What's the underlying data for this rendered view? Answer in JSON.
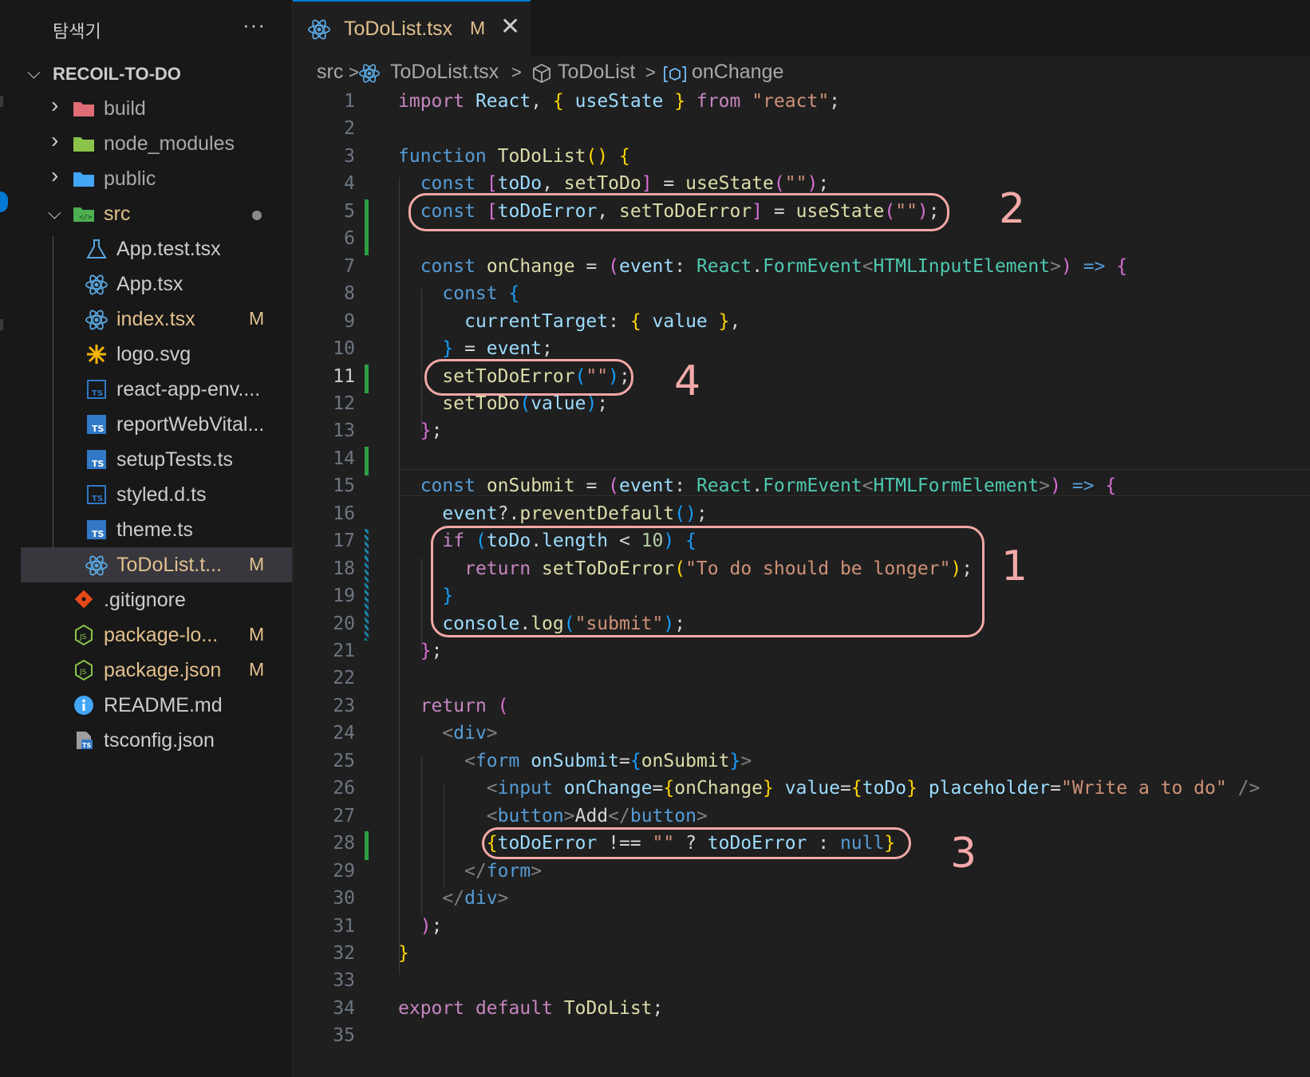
{
  "explorer": {
    "title": "탐색기",
    "more": "···",
    "project": "RECOIL-TO-DO",
    "items": [
      {
        "label": "build",
        "kind": "folder",
        "icon_color": "#e06c75"
      },
      {
        "label": "node_modules",
        "kind": "folder",
        "icon_color": "#8bc34a"
      },
      {
        "label": "public",
        "kind": "folder",
        "icon_color": "#42a5f5"
      },
      {
        "label": "src",
        "kind": "folder-open",
        "icon_color": "#4caf50"
      },
      {
        "label": "App.test.tsx",
        "kind": "test"
      },
      {
        "label": "App.tsx",
        "kind": "react"
      },
      {
        "label": "index.tsx",
        "kind": "react",
        "badge": "M"
      },
      {
        "label": "logo.svg",
        "kind": "svg"
      },
      {
        "label": "react-app-env....",
        "kind": "ts-outline"
      },
      {
        "label": "reportWebVital...",
        "kind": "ts"
      },
      {
        "label": "setupTests.ts",
        "kind": "ts"
      },
      {
        "label": "styled.d.ts",
        "kind": "ts-outline"
      },
      {
        "label": "theme.ts",
        "kind": "ts"
      },
      {
        "label": "ToDoList.t...",
        "kind": "react",
        "badge": "M"
      },
      {
        "label": ".gitignore",
        "kind": "git"
      },
      {
        "label": "package-lo...",
        "kind": "node",
        "badge": "M"
      },
      {
        "label": "package.json",
        "kind": "node",
        "badge": "M"
      },
      {
        "label": "README.md",
        "kind": "info"
      },
      {
        "label": "tsconfig.json",
        "kind": "tsconfig"
      }
    ]
  },
  "tab": {
    "name": "ToDoList.tsx",
    "modified": "M",
    "close": "✕"
  },
  "breadcrumb": {
    "src": "src",
    "file": "ToDoList.tsx",
    "component": "ToDoList",
    "symbol": "onChange",
    "sep": ">"
  },
  "editor": {
    "current_line": 11,
    "lines": [
      [
        [
          "cf",
          "import"
        ],
        [
          "pl",
          " "
        ],
        [
          "va",
          "React"
        ],
        [
          "pl",
          ", "
        ],
        [
          "br1",
          "{"
        ],
        [
          "pl",
          " "
        ],
        [
          "va",
          "useState"
        ],
        [
          "pl",
          " "
        ],
        [
          "br1",
          "}"
        ],
        [
          "pl",
          " "
        ],
        [
          "cf",
          "from"
        ],
        [
          "pl",
          " "
        ],
        [
          "st",
          "\"react\""
        ],
        [
          "pl",
          ";"
        ]
      ],
      [],
      [
        [
          "kw",
          "function"
        ],
        [
          "pl",
          " "
        ],
        [
          "fn",
          "ToDoList"
        ],
        [
          "br1",
          "()"
        ],
        [
          "pl",
          " "
        ],
        [
          "br1",
          "{"
        ]
      ],
      [
        [
          "pl",
          "  "
        ],
        [
          "kw",
          "const"
        ],
        [
          "pl",
          " "
        ],
        [
          "br2",
          "["
        ],
        [
          "va",
          "toDo"
        ],
        [
          "pl",
          ", "
        ],
        [
          "fn",
          "setToDo"
        ],
        [
          "br2",
          "]"
        ],
        [
          "pl",
          " = "
        ],
        [
          "fn",
          "useState"
        ],
        [
          "br2",
          "("
        ],
        [
          "st",
          "\"\""
        ],
        [
          "br2",
          ")"
        ],
        [
          "pl",
          ";"
        ]
      ],
      [
        [
          "pl",
          "  "
        ],
        [
          "kw",
          "const"
        ],
        [
          "pl",
          " "
        ],
        [
          "br2",
          "["
        ],
        [
          "va",
          "toDoError"
        ],
        [
          "pl",
          ", "
        ],
        [
          "fn",
          "setToDoError"
        ],
        [
          "br2",
          "]"
        ],
        [
          "pl",
          " = "
        ],
        [
          "fn",
          "useState"
        ],
        [
          "br2",
          "("
        ],
        [
          "st",
          "\"\""
        ],
        [
          "br2",
          ")"
        ],
        [
          "pl",
          ";"
        ]
      ],
      [],
      [
        [
          "pl",
          "  "
        ],
        [
          "kw",
          "const"
        ],
        [
          "pl",
          " "
        ],
        [
          "fn",
          "onChange"
        ],
        [
          "pl",
          " = "
        ],
        [
          "br2",
          "("
        ],
        [
          "va",
          "event"
        ],
        [
          "pl",
          ": "
        ],
        [
          "ty",
          "React"
        ],
        [
          "pl",
          "."
        ],
        [
          "ty",
          "FormEvent"
        ],
        [
          "tg",
          "<"
        ],
        [
          "ty",
          "HTMLInputElement"
        ],
        [
          "tg",
          ">"
        ],
        [
          "br2",
          ")"
        ],
        [
          "pl",
          " "
        ],
        [
          "kw",
          "=>"
        ],
        [
          "pl",
          " "
        ],
        [
          "br2",
          "{"
        ]
      ],
      [
        [
          "pl",
          "    "
        ],
        [
          "kw",
          "const"
        ],
        [
          "pl",
          " "
        ],
        [
          "br3",
          "{"
        ]
      ],
      [
        [
          "pl",
          "      "
        ],
        [
          "va",
          "currentTarget"
        ],
        [
          "pl",
          ": "
        ],
        [
          "br1",
          "{"
        ],
        [
          "pl",
          " "
        ],
        [
          "va",
          "value"
        ],
        [
          "pl",
          " "
        ],
        [
          "br1",
          "}"
        ],
        [
          "pl",
          ","
        ]
      ],
      [
        [
          "pl",
          "    "
        ],
        [
          "br3",
          "}"
        ],
        [
          "pl",
          " = "
        ],
        [
          "va",
          "event"
        ],
        [
          "pl",
          ";"
        ]
      ],
      [
        [
          "pl",
          "    "
        ],
        [
          "fn",
          "setToDoError"
        ],
        [
          "br3",
          "("
        ],
        [
          "st",
          "\"\""
        ],
        [
          "br3",
          ")"
        ],
        [
          "pl",
          ";"
        ]
      ],
      [
        [
          "pl",
          "    "
        ],
        [
          "fn",
          "setToDo"
        ],
        [
          "br3",
          "("
        ],
        [
          "va",
          "value"
        ],
        [
          "br3",
          ")"
        ],
        [
          "pl",
          ";"
        ]
      ],
      [
        [
          "pl",
          "  "
        ],
        [
          "br2",
          "}"
        ],
        [
          "pl",
          ";"
        ]
      ],
      [],
      [
        [
          "pl",
          "  "
        ],
        [
          "kw",
          "const"
        ],
        [
          "pl",
          " "
        ],
        [
          "fn",
          "onSubmit"
        ],
        [
          "pl",
          " = "
        ],
        [
          "br2",
          "("
        ],
        [
          "va",
          "event"
        ],
        [
          "pl",
          ": "
        ],
        [
          "ty",
          "React"
        ],
        [
          "pl",
          "."
        ],
        [
          "ty",
          "FormEvent"
        ],
        [
          "tg",
          "<"
        ],
        [
          "ty",
          "HTMLFormElement"
        ],
        [
          "tg",
          ">"
        ],
        [
          "br2",
          ")"
        ],
        [
          "pl",
          " "
        ],
        [
          "kw",
          "=>"
        ],
        [
          "pl",
          " "
        ],
        [
          "br2",
          "{"
        ]
      ],
      [
        [
          "pl",
          "    "
        ],
        [
          "va",
          "event"
        ],
        [
          "pl",
          "?."
        ],
        [
          "fn",
          "preventDefault"
        ],
        [
          "br3",
          "()"
        ],
        [
          "pl",
          ";"
        ]
      ],
      [
        [
          "pl",
          "    "
        ],
        [
          "cf",
          "if"
        ],
        [
          "pl",
          " "
        ],
        [
          "br3",
          "("
        ],
        [
          "va",
          "toDo"
        ],
        [
          "pl",
          "."
        ],
        [
          "va",
          "length"
        ],
        [
          "pl",
          " < "
        ],
        [
          "nu",
          "10"
        ],
        [
          "br3",
          ")"
        ],
        [
          "pl",
          " "
        ],
        [
          "br3",
          "{"
        ]
      ],
      [
        [
          "pl",
          "      "
        ],
        [
          "cf",
          "return"
        ],
        [
          "pl",
          " "
        ],
        [
          "fn",
          "setToDoError"
        ],
        [
          "br1",
          "("
        ],
        [
          "st",
          "\"To do should be longer\""
        ],
        [
          "br1",
          ")"
        ],
        [
          "pl",
          ";"
        ]
      ],
      [
        [
          "pl",
          "    "
        ],
        [
          "br3",
          "}"
        ]
      ],
      [
        [
          "pl",
          "    "
        ],
        [
          "va",
          "console"
        ],
        [
          "pl",
          "."
        ],
        [
          "fn",
          "log"
        ],
        [
          "br3",
          "("
        ],
        [
          "st",
          "\"submit\""
        ],
        [
          "br3",
          ")"
        ],
        [
          "pl",
          ";"
        ]
      ],
      [
        [
          "pl",
          "  "
        ],
        [
          "br2",
          "}"
        ],
        [
          "pl",
          ";"
        ]
      ],
      [],
      [
        [
          "pl",
          "  "
        ],
        [
          "cf",
          "return"
        ],
        [
          "pl",
          " "
        ],
        [
          "br2",
          "("
        ]
      ],
      [
        [
          "pl",
          "    "
        ],
        [
          "tg",
          "<"
        ],
        [
          "tn",
          "div"
        ],
        [
          "tg",
          ">"
        ]
      ],
      [
        [
          "pl",
          "      "
        ],
        [
          "tg",
          "<"
        ],
        [
          "tn",
          "form"
        ],
        [
          "pl",
          " "
        ],
        [
          "at",
          "onSubmit"
        ],
        [
          "pl",
          "="
        ],
        [
          "br3",
          "{"
        ],
        [
          "fn",
          "onSubmit"
        ],
        [
          "br3",
          "}"
        ],
        [
          "tg",
          ">"
        ]
      ],
      [
        [
          "pl",
          "        "
        ],
        [
          "tg",
          "<"
        ],
        [
          "tn",
          "input"
        ],
        [
          "pl",
          " "
        ],
        [
          "at",
          "onChange"
        ],
        [
          "pl",
          "="
        ],
        [
          "br1",
          "{"
        ],
        [
          "fn",
          "onChange"
        ],
        [
          "br1",
          "}"
        ],
        [
          "pl",
          " "
        ],
        [
          "at",
          "value"
        ],
        [
          "pl",
          "="
        ],
        [
          "br1",
          "{"
        ],
        [
          "va",
          "toDo"
        ],
        [
          "br1",
          "}"
        ],
        [
          "pl",
          " "
        ],
        [
          "at",
          "placeholder"
        ],
        [
          "pl",
          "="
        ],
        [
          "st",
          "\"Write a to do\""
        ],
        [
          "pl",
          " "
        ],
        [
          "tg",
          "/>"
        ]
      ],
      [
        [
          "pl",
          "        "
        ],
        [
          "tg",
          "<"
        ],
        [
          "tn",
          "button"
        ],
        [
          "tg",
          ">"
        ],
        [
          "pl",
          "Add"
        ],
        [
          "tg",
          "</"
        ],
        [
          "tn",
          "button"
        ],
        [
          "tg",
          ">"
        ]
      ],
      [
        [
          "pl",
          "        "
        ],
        [
          "br1",
          "{"
        ],
        [
          "va",
          "toDoError"
        ],
        [
          "pl",
          " !== "
        ],
        [
          "st",
          "\"\""
        ],
        [
          "pl",
          " ? "
        ],
        [
          "va",
          "toDoError"
        ],
        [
          "pl",
          " : "
        ],
        [
          "kw",
          "null"
        ],
        [
          "br1",
          "}"
        ]
      ],
      [
        [
          "pl",
          "      "
        ],
        [
          "tg",
          "</"
        ],
        [
          "tn",
          "form"
        ],
        [
          "tg",
          ">"
        ]
      ],
      [
        [
          "pl",
          "    "
        ],
        [
          "tg",
          "</"
        ],
        [
          "tn",
          "div"
        ],
        [
          "tg",
          ">"
        ]
      ],
      [
        [
          "pl",
          "  "
        ],
        [
          "br2",
          ")"
        ],
        [
          "pl",
          ";"
        ]
      ],
      [
        [
          "br1",
          "}"
        ]
      ],
      [],
      [
        [
          "cf",
          "export"
        ],
        [
          "pl",
          " "
        ],
        [
          "cf",
          "default"
        ],
        [
          "pl",
          " "
        ],
        [
          "fn",
          "ToDoList"
        ],
        [
          "pl",
          ";"
        ]
      ],
      []
    ],
    "git_added_lines": [
      5,
      6,
      11,
      14,
      28
    ],
    "git_modified_lines": [
      17,
      18,
      19,
      20
    ]
  },
  "annotations": [
    "1",
    "2",
    "3",
    "4"
  ],
  "colors": {
    "accent": "#0078d4",
    "modified": "#e2c08d",
    "annotation": "#f2a7a7",
    "added": "#2ea043"
  }
}
